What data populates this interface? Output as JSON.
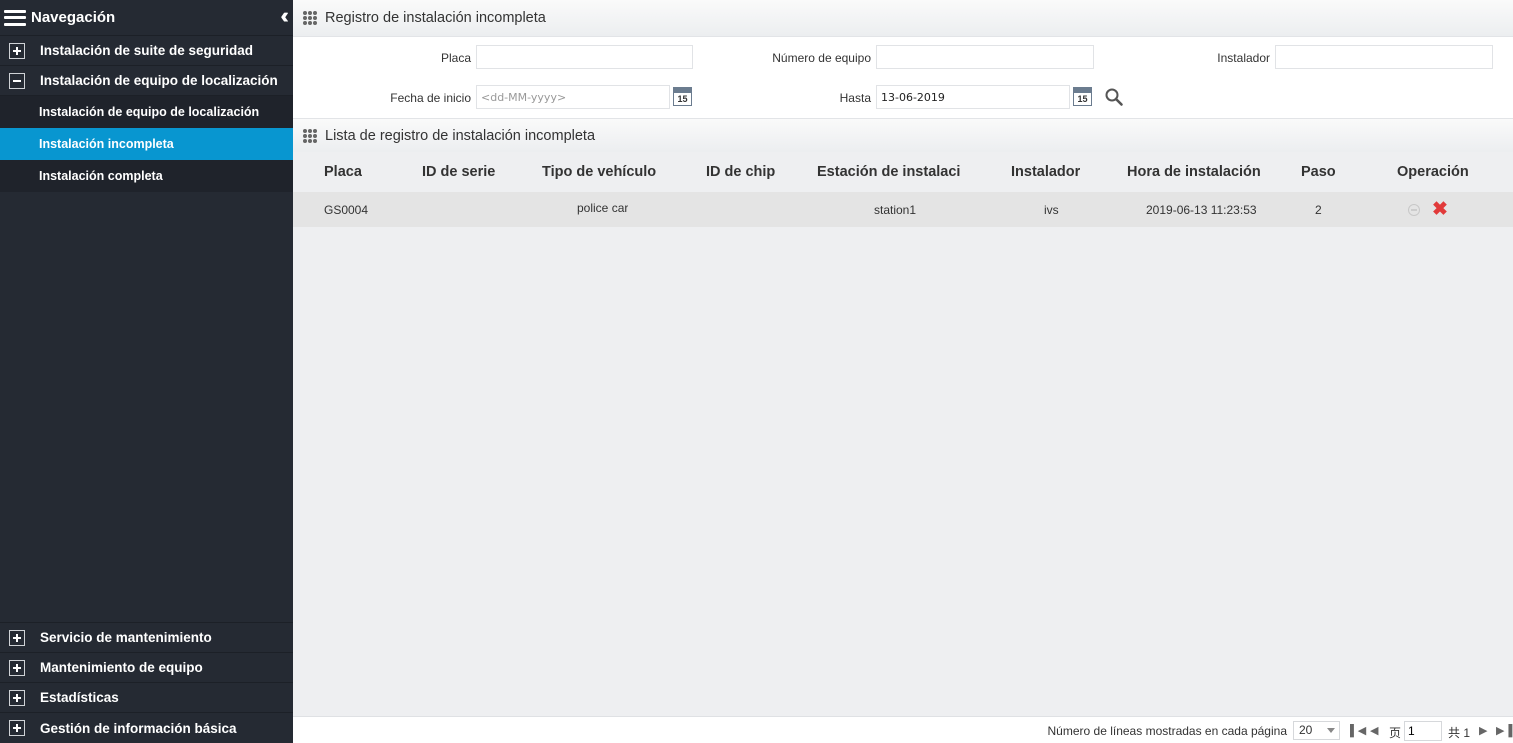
{
  "sidebar": {
    "title": "Navegación",
    "groups_top": [
      {
        "label": "Instalación de suite de seguridad",
        "expanded": false
      },
      {
        "label": "Instalación de equipo de localización",
        "expanded": true
      }
    ],
    "sub_items": [
      {
        "label": "Instalación de equipo de localización",
        "active": false
      },
      {
        "label": "Instalación incompleta",
        "active": true
      },
      {
        "label": "Instalación completa",
        "active": false
      }
    ],
    "groups_bottom": [
      {
        "label": "Servicio de mantenimiento"
      },
      {
        "label": "Mantenimiento de equipo"
      },
      {
        "label": "Estadísticas"
      },
      {
        "label": "Gestión de información básica"
      }
    ]
  },
  "search_section": {
    "title": "Registro de instalación incompleta",
    "placa_label": "Placa",
    "placa_value": "",
    "numero_equipo_label": "Número de equipo",
    "numero_equipo_value": "",
    "instalador_label": "Instalador",
    "instalador_value": "",
    "fecha_inicio_label": "Fecha de inicio",
    "fecha_inicio_placeholder": "<dd-MM-yyyy>",
    "hasta_label": "Hasta",
    "hasta_value": "13-06-2019",
    "calendar_day": "15"
  },
  "list_section": {
    "title": "Lista de registro de instalación incompleta",
    "columns": [
      "Placa",
      "ID de serie",
      "Tipo de vehículo",
      "ID de chip",
      "Estación de instalaci",
      "Instalador",
      "Hora de instalación",
      "Paso",
      "Operación"
    ],
    "rows": [
      {
        "placa": "GS0004",
        "id_serie": "",
        "tipo_vehiculo": "police car",
        "id_chip": "",
        "estacion": "station1",
        "instalador": "ivs",
        "hora": "2019-06-13 11:23:53",
        "paso": "2"
      }
    ]
  },
  "pager": {
    "lines_label": "Número de líneas mostradas en cada página",
    "page_size": "20",
    "page_prefix": "页",
    "current_page": "1",
    "total_label": "共 1"
  },
  "colors": {
    "sidebar_bg": "#252a33",
    "active_item": "#0896d0",
    "delete_red": "#e13a3a"
  }
}
